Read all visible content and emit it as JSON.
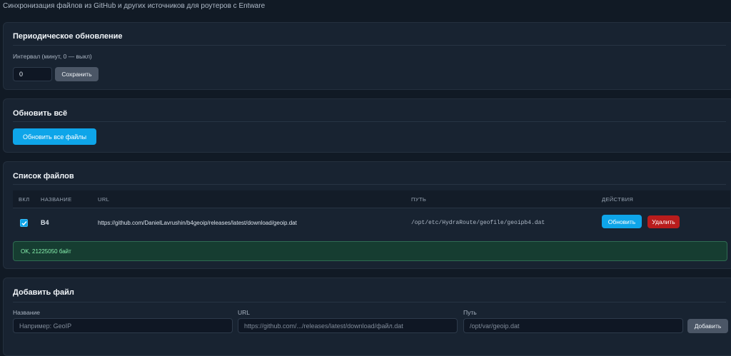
{
  "header": {
    "subtitle": "Синхронизация файлов из GitHub и других источников для роутеров с Entware"
  },
  "periodic": {
    "title": "Периодическое обновление",
    "interval_label": "Интервал (минут, 0 — выкл)",
    "interval_value": "0",
    "save_label": "Сохранить"
  },
  "update_all": {
    "title": "Обновить всё",
    "button_label": "Обновить все файлы"
  },
  "files": {
    "title": "Список файлов",
    "columns": {
      "enabled": "ВКЛ",
      "name": "НАЗВАНИЕ",
      "url": "URL",
      "path": "ПУТЬ",
      "actions": "ДЕЙСТВИЯ"
    },
    "rows": [
      {
        "enabled": true,
        "name": "B4",
        "url": "https://github.com/DanielLavrushin/b4geoip/releases/latest/download/geoip.dat",
        "path": "/opt/etc/HydraRoute/geofile/geoipb4.dat",
        "update_label": "Обновить",
        "delete_label": "Удалить"
      }
    ],
    "status": "OK, 21225050 байт"
  },
  "add_file": {
    "title": "Добавить файл",
    "name_label": "Название",
    "name_placeholder": "Например: GeoIP",
    "url_label": "URL",
    "url_placeholder": "https://github.com/.../releases/latest/download/файл.dat",
    "path_label": "Путь",
    "path_placeholder": "/opt/var/geoip.dat",
    "add_label": "Добавить"
  },
  "colors": {
    "background": "#111a25",
    "card": "#182331",
    "accent_blue": "#0ea5e9",
    "danger_red": "#b91c1c",
    "success_green": "#163d31"
  }
}
